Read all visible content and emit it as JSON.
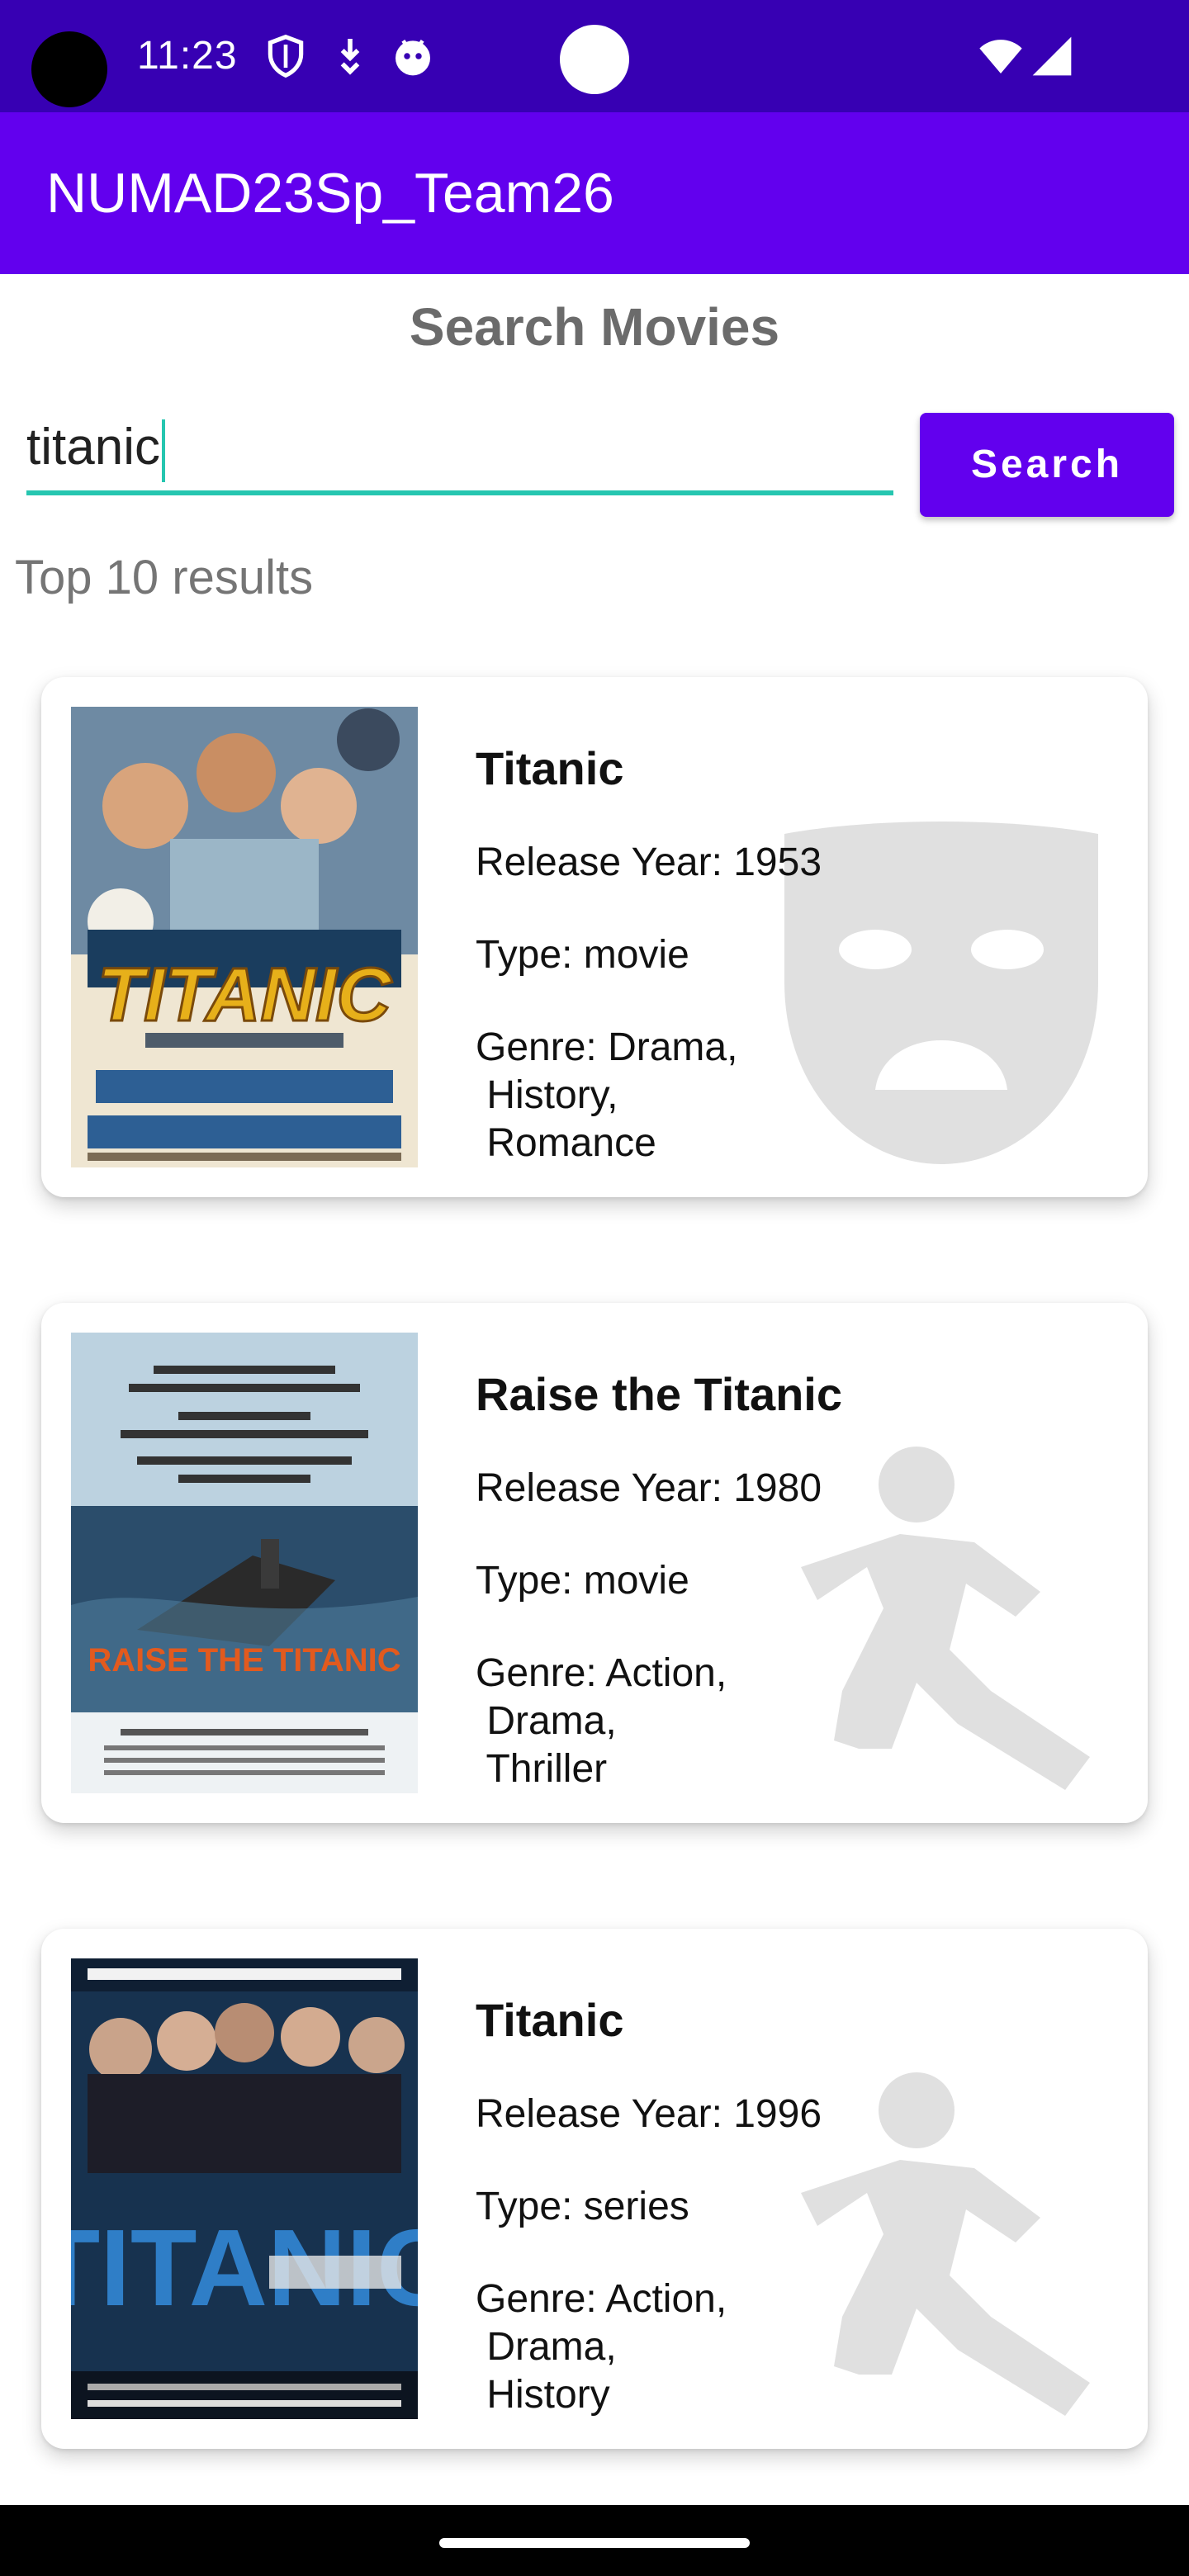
{
  "status_bar": {
    "time": "11:23",
    "icons": [
      "shield-icon",
      "download-icon",
      "android-icon",
      "wifi-icon",
      "signal-icon"
    ]
  },
  "app_bar": {
    "title": "NUMAD23Sp_Team26"
  },
  "page": {
    "title": "Search Movies",
    "search": {
      "value": "titanic",
      "button_label": "Search"
    },
    "results_label": "Top 10 results"
  },
  "results": [
    {
      "title": "Titanic",
      "release_year": "Release Year: 1953",
      "type": "Type: movie",
      "genre_line1": "Genre: Drama,",
      "genre_line2": " History,",
      "genre_line3": " Romance",
      "genre_icon": "drama-mask-icon",
      "poster_text": "TITANIC"
    },
    {
      "title": "Raise the Titanic",
      "release_year": "Release Year: 1980",
      "type": "Type: movie",
      "genre_line1": "Genre: Action,",
      "genre_line2": " Drama,",
      "genre_line3": " Thriller",
      "genre_icon": "running-person-icon",
      "poster_text": "RAISE THE TITANIC"
    },
    {
      "title": "Titanic",
      "release_year": "Release Year: 1996",
      "type": "Type: series",
      "genre_line1": "Genre: Action,",
      "genre_line2": " Drama,",
      "genre_line3": " History",
      "genre_icon": "running-person-icon",
      "poster_text": "TITANIC"
    }
  ],
  "colors": {
    "status_bar": "#3700b3",
    "primary": "#6200ee",
    "accent": "#26c6b0",
    "icon_gray": "#e0e0e0"
  }
}
